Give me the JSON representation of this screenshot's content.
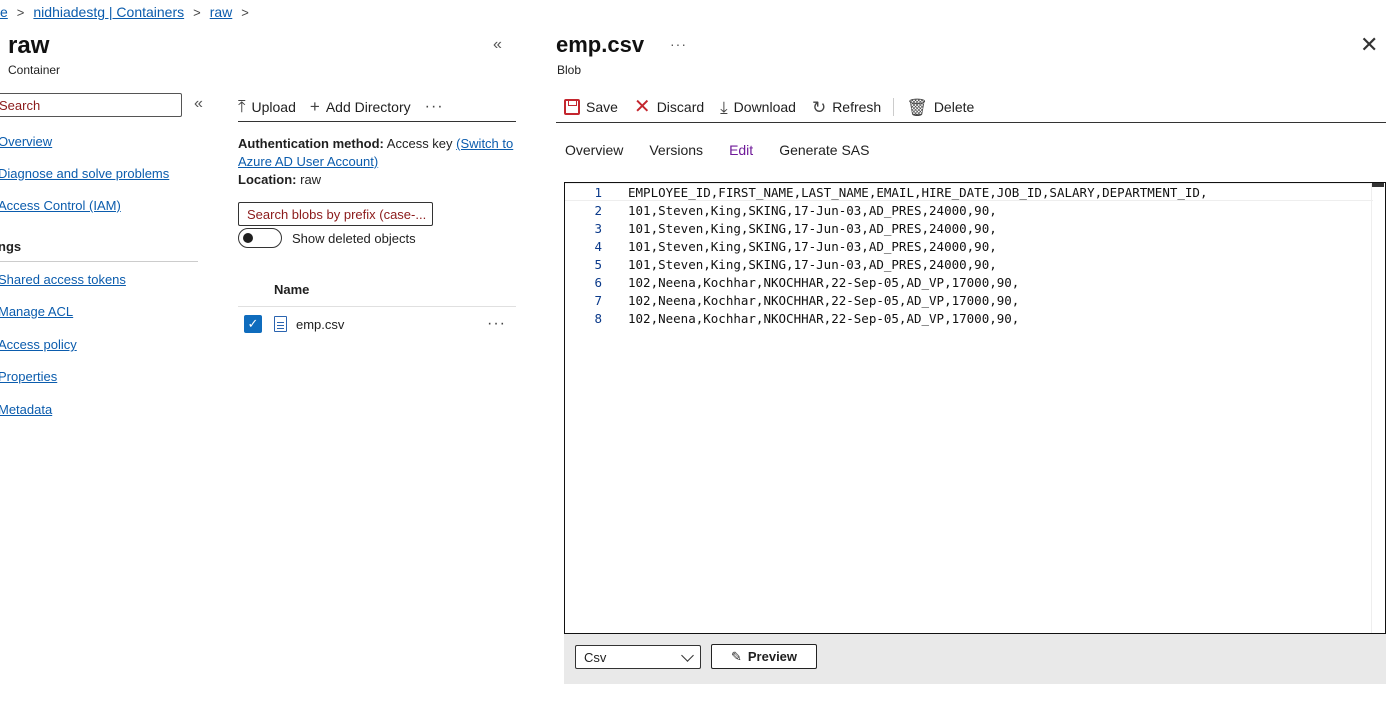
{
  "breadcrumb": {
    "items": [
      "e",
      "nidhiadestg | Containers",
      "raw"
    ]
  },
  "container": {
    "title": "raw",
    "subtitle": "Container"
  },
  "nav": {
    "search_placeholder": "Search",
    "collapse_icon": "double-chevron-left-icon",
    "items": [
      "Overview",
      "Diagnose and solve problems",
      "Access Control (IAM)"
    ],
    "section_label": "ngs",
    "settings_items": [
      "Shared access tokens",
      "Manage ACL",
      "Access policy",
      "Properties",
      "Metadata"
    ]
  },
  "middle": {
    "toolbar": {
      "upload": "Upload",
      "add_directory": "Add Directory",
      "more": "···"
    },
    "auth_label": "Authentication method:",
    "auth_value": "Access key",
    "auth_switch": "(Switch to Azure AD User Account)",
    "location_label": "Location:",
    "location_value": "raw",
    "blob_search_placeholder": "Search blobs by prefix (case-...",
    "show_deleted_label": "Show deleted objects",
    "show_deleted_on": false,
    "column_name": "Name",
    "files": [
      {
        "name": "emp.csv",
        "selected": true
      }
    ],
    "row_more": "···"
  },
  "blob": {
    "title": "emp.csv",
    "more": "···",
    "subtitle": "Blob",
    "toolbar": {
      "save": "Save",
      "discard": "Discard",
      "download": "Download",
      "refresh": "Refresh",
      "delete": "Delete"
    },
    "tabs": [
      "Overview",
      "Versions",
      "Edit",
      "Generate SAS"
    ],
    "active_tab": "Edit",
    "lines": [
      {
        "n": "1",
        "text": "EMPLOYEE_ID,FIRST_NAME,LAST_NAME,EMAIL,HIRE_DATE,JOB_ID,SALARY,DEPARTMENT_ID,"
      },
      {
        "n": "2",
        "text": "101,Steven,King,SKING,17-Jun-03,AD_PRES,24000,90,"
      },
      {
        "n": "3",
        "text": "101,Steven,King,SKING,17-Jun-03,AD_PRES,24000,90,"
      },
      {
        "n": "4",
        "text": "101,Steven,King,SKING,17-Jun-03,AD_PRES,24000,90,"
      },
      {
        "n": "5",
        "text": "101,Steven,King,SKING,17-Jun-03,AD_PRES,24000,90,"
      },
      {
        "n": "6",
        "text": "102,Neena,Kochhar,NKOCHHAR,22-Sep-05,AD_VP,17000,90,"
      },
      {
        "n": "7",
        "text": "102,Neena,Kochhar,NKOCHHAR,22-Sep-05,AD_VP,17000,90,"
      },
      {
        "n": "8",
        "text": "102,Neena,Kochhar,NKOCHHAR,22-Sep-05,AD_VP,17000,90,"
      }
    ],
    "format_value": "Csv",
    "preview_label": "Preview"
  },
  "colors": {
    "link": "#0b5cad",
    "accent": "#0f6cbd",
    "danger": "#c4262e",
    "active_tab": "#6f1a99"
  }
}
